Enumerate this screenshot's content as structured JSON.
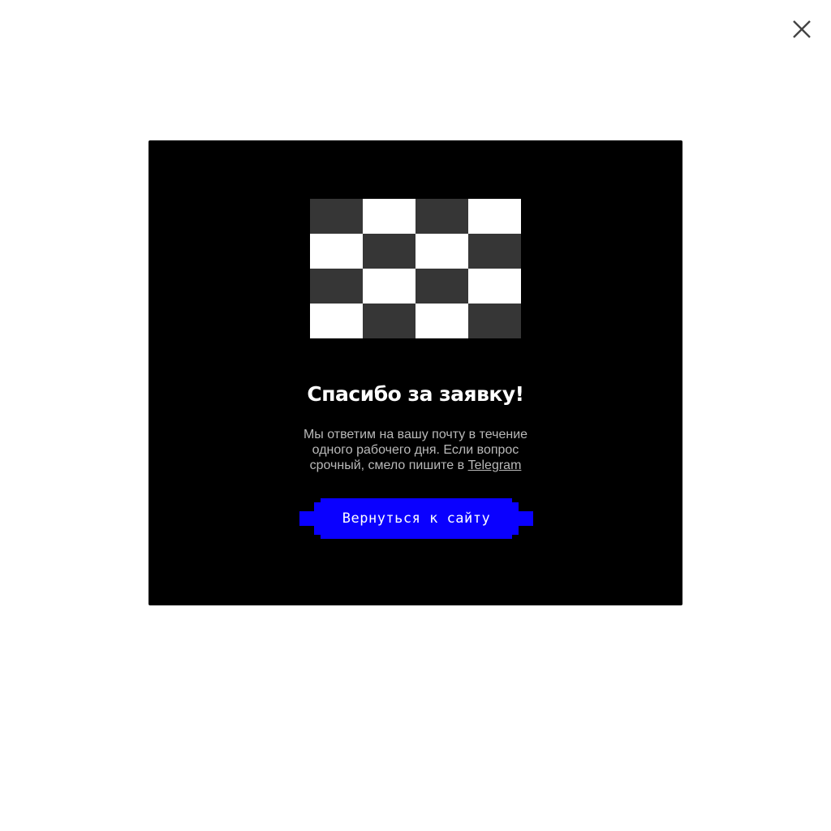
{
  "close": {
    "icon": "close-icon"
  },
  "modal": {
    "illustration": {
      "icon": "checkerboard-flag-icon",
      "rows": [
        [
          "dark",
          "light",
          "dark",
          "light"
        ],
        [
          "light",
          "dark",
          "light",
          "dark"
        ],
        [
          "dark",
          "light",
          "dark",
          "light"
        ],
        [
          "light",
          "dark",
          "light",
          "dark"
        ]
      ]
    },
    "title": "Спасибо за заявку!",
    "message_text": "Мы ответим на вашу почту в течение одного рабочего дня. Если вопрос срочный, смело пишите в",
    "message_link": "Telegram",
    "button_label": "Вернуться к сайту"
  },
  "colors": {
    "page_background": "#ffffff",
    "modal_background": "#000000",
    "button_background": "#0a00ff",
    "checker_dark": "#363636",
    "checker_light": "#ffffff",
    "text_muted": "#b9b9b9"
  }
}
